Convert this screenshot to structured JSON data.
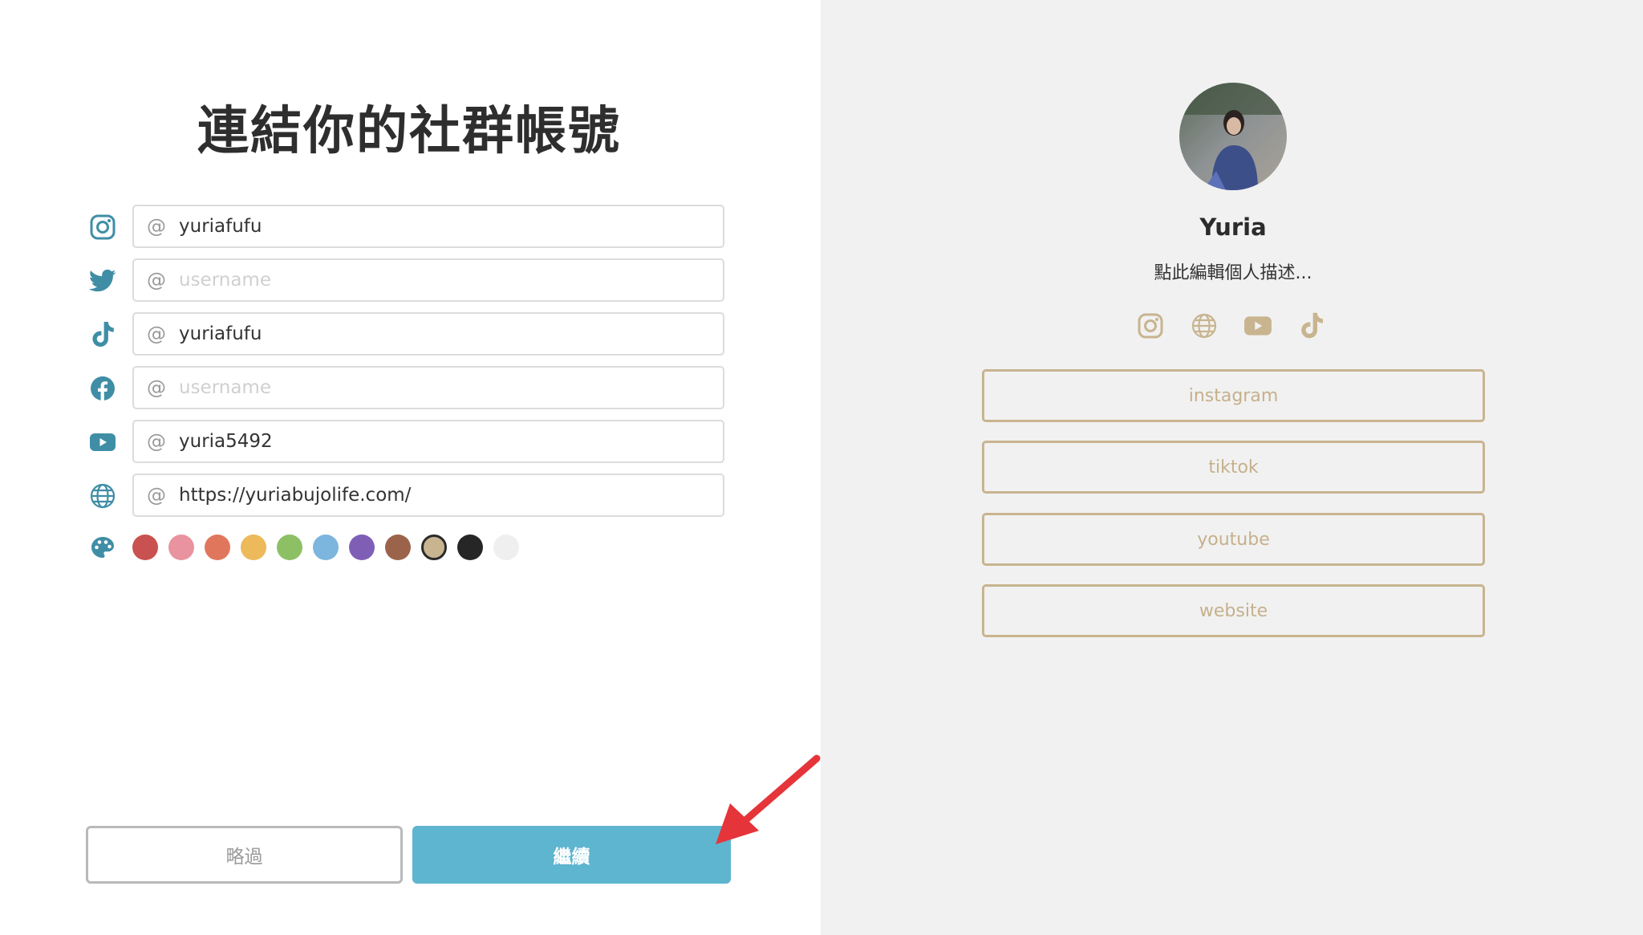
{
  "page": {
    "title": "連結你的社群帳號"
  },
  "fields": [
    {
      "id": "instagram",
      "icon": "instagram-icon",
      "prefix": "@",
      "value": "yuriafufu",
      "placeholder": "username"
    },
    {
      "id": "twitter",
      "icon": "twitter-icon",
      "prefix": "@",
      "value": "",
      "placeholder": "username"
    },
    {
      "id": "tiktok",
      "icon": "tiktok-icon",
      "prefix": "@",
      "value": "yuriafufu",
      "placeholder": "username"
    },
    {
      "id": "facebook",
      "icon": "facebook-icon",
      "prefix": "@",
      "value": "",
      "placeholder": "username"
    },
    {
      "id": "youtube",
      "icon": "youtube-icon",
      "prefix": "@",
      "value": "yuria5492",
      "placeholder": "username"
    },
    {
      "id": "website",
      "icon": "globe-icon",
      "prefix": "@",
      "value": "https://yuriabujolife.com/",
      "placeholder": "username"
    }
  ],
  "palette": {
    "icon": "palette-icon",
    "colors": [
      "#c9514f",
      "#e8939f",
      "#e0775c",
      "#ecb95b",
      "#8dc065",
      "#7cb5de",
      "#7f5fb6",
      "#9a634a",
      "#c8b48f",
      "#262626",
      "#f1f1f1"
    ],
    "selected": "#c8b48f"
  },
  "actions": {
    "skip_label": "略過",
    "continue_label": "繼續"
  },
  "colors": {
    "accent": "#5db5cf",
    "icon": "#3f8ea6",
    "theme": "#c8b48f",
    "arrow": "#e5353a"
  },
  "preview": {
    "name": "Yuria",
    "bio": "點此編輯個人描述...",
    "icons": [
      "instagram-icon",
      "globe-icon",
      "youtube-icon",
      "tiktok-icon"
    ],
    "links": [
      "instagram",
      "tiktok",
      "youtube",
      "website"
    ]
  }
}
